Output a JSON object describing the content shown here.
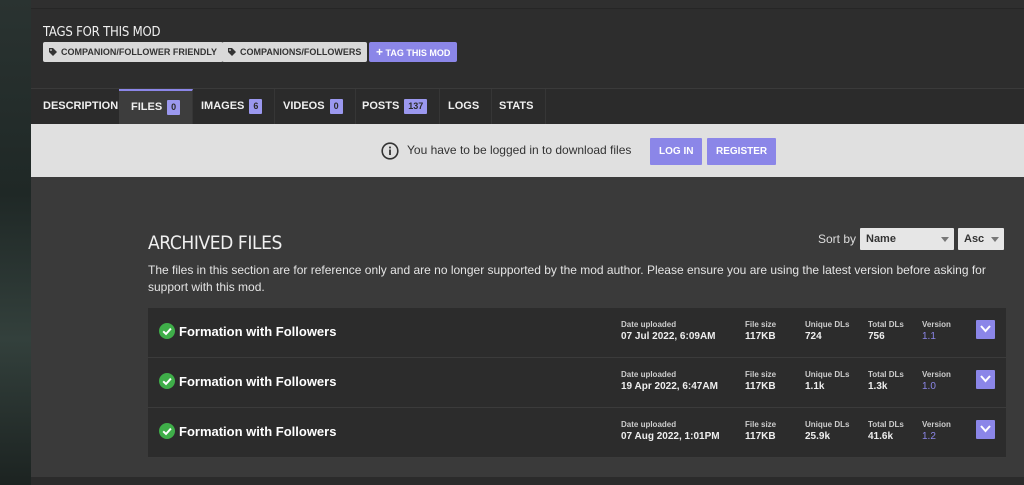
{
  "tags": {
    "title": "TAGS FOR THIS MOD",
    "items": [
      "COMPANION/FOLLOWER FRIENDLY",
      "COMPANIONS/FOLLOWERS"
    ],
    "add_label": "TAG THIS MOD"
  },
  "tabs": [
    {
      "label": "DESCRIPTION",
      "count": null
    },
    {
      "label": "FILES",
      "count": "0"
    },
    {
      "label": "IMAGES",
      "count": "6"
    },
    {
      "label": "VIDEOS",
      "count": "0"
    },
    {
      "label": "POSTS",
      "count": "137"
    },
    {
      "label": "LOGS",
      "count": null
    },
    {
      "label": "STATS",
      "count": null
    }
  ],
  "login": {
    "message": "You have to be logged in to download files",
    "login_label": "LOG IN",
    "register_label": "REGISTER"
  },
  "archived": {
    "title": "ARCHIVED FILES",
    "sort_label": "Sort by",
    "sort_field": "Name",
    "sort_order": "Asc",
    "description": "The files in this section are for reference only and are no longer supported by the mod author. Please ensure you are using the latest version before asking for support with this mod.",
    "column_labels": {
      "date": "Date uploaded",
      "size": "File size",
      "unique": "Unique DLs",
      "total": "Total DLs",
      "version": "Version"
    },
    "files": [
      {
        "name": "Formation with Followers",
        "date": "07 Jul 2022, 6:09AM",
        "size": "117KB",
        "unique": "724",
        "total": "756",
        "version": "1.1"
      },
      {
        "name": "Formation with Followers",
        "date": "19 Apr 2022, 6:47AM",
        "size": "117KB",
        "unique": "1.1k",
        "total": "1.3k",
        "version": "1.0"
      },
      {
        "name": "Formation with Followers",
        "date": "07 Aug 2022, 1:01PM",
        "size": "117KB",
        "unique": "25.9k",
        "total": "41.6k",
        "version": "1.2"
      }
    ]
  },
  "colors": {
    "accent": "#8b86e8",
    "success": "#3fae49"
  }
}
